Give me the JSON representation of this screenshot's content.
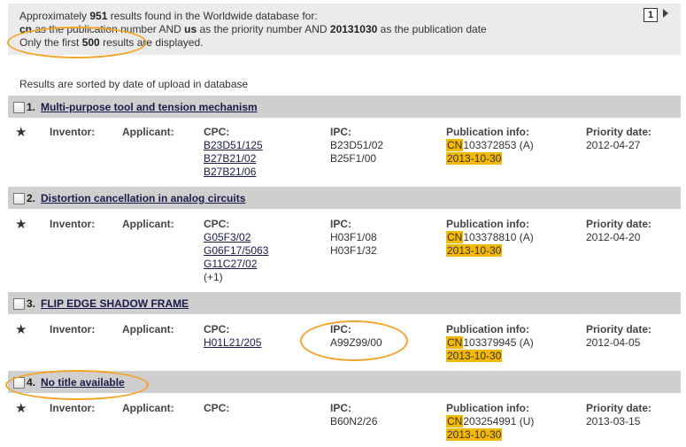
{
  "summary": {
    "line1_prefix": "Approximately",
    "count": "951",
    "line1_suffix": "results found in the Worldwide database for:",
    "line2_a": "cn",
    "line2_b": "as the publication number AND",
    "line2_c": "us",
    "line2_d": "as the priority number AND",
    "line2_e": "20131030",
    "line2_f": "as the publication date",
    "line3_prefix": "Only the first",
    "line3_count": "500",
    "line3_suffix": "results are displayed."
  },
  "pager": {
    "page": "1"
  },
  "sort_note": "Results are sorted by date of upload in database",
  "labels": {
    "inventor": "Inventor:",
    "applicant": "Applicant:",
    "cpc": "CPC:",
    "ipc": "IPC:",
    "publication_info": "Publication info:",
    "priority_date": "Priority date:"
  },
  "results": [
    {
      "num": "1.",
      "title": "Multi-purpose tool and tension mechanism",
      "cpc": [
        "B23D51/125",
        "B27B21/02",
        "B27B21/06"
      ],
      "cpc_more": "",
      "ipc": [
        "B23D51/02",
        "B25F1/00"
      ],
      "pub_cc": "CN",
      "pub_num": "103372853 (A)",
      "pub_date": "2013-10-30",
      "priority_date": "2012-04-27"
    },
    {
      "num": "2.",
      "title": "Distortion cancellation in analog circuits",
      "cpc": [
        "G05F3/02",
        "G06F17/5063",
        "G11C27/02"
      ],
      "cpc_more": "(+1)",
      "ipc": [
        "H03F1/08",
        "H03F1/32"
      ],
      "pub_cc": "CN",
      "pub_num": "103378810 (A)",
      "pub_date": "2013-10-30",
      "priority_date": "2012-04-20"
    },
    {
      "num": "3.",
      "title": "FLIP EDGE SHADOW FRAME",
      "cpc": [
        "H01L21/205"
      ],
      "cpc_more": "",
      "ipc": [
        "A99Z99/00"
      ],
      "pub_cc": "CN",
      "pub_num": "103379945 (A)",
      "pub_date": "2013-10-30",
      "priority_date": "2012-04-05"
    },
    {
      "num": "4.",
      "title": "No title available",
      "cpc": [],
      "cpc_more": "",
      "ipc": [
        "B60N2/26"
      ],
      "pub_cc": "CN",
      "pub_num": "203254991 (U)",
      "pub_date": "2013-10-30",
      "priority_date": "2013-03-15"
    }
  ],
  "colors": {
    "highlight": "#f5b800",
    "annotation_oval": "#f2a428",
    "row_header": "#cfcfcf",
    "summary_bg": "#ebebeb"
  }
}
